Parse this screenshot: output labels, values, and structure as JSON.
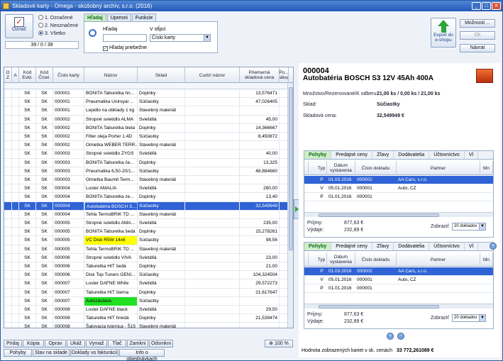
{
  "window": {
    "title": "Skladové karty - Omega - skúšobný archív, s.r.o. (2016)"
  },
  "top": {
    "mark_label": "Označ",
    "radio": [
      "1. Označené",
      "2. Neoznačené",
      "3. Všetko"
    ],
    "counter": "39 / 0 / 39",
    "tabs": [
      "Hľadaj",
      "Upresni",
      "Funkcie"
    ],
    "search_label": "Hľadaj",
    "search_value": "",
    "column_label": "V stĺpci",
    "column_value": "Číslo karty",
    "progressive_label": "Hľadaj priebežne",
    "export_label": "Export do e-shopu",
    "options_label": "Možnosti ...",
    "ok_label": "Ok",
    "return_label": "Návrat"
  },
  "grid": {
    "headers": [
      "O Z",
      "A",
      "Kód Evid.",
      "Kód Čísel.",
      "Číslo karty",
      "Názov",
      "Sklad",
      "Cudzí názov",
      "Priemerná skladová cena",
      "Po... nákup"
    ],
    "rows": [
      [
        "SK",
        "SK",
        "000001",
        "BONITA Taburetka hn...",
        "Doplnky",
        "13,576471",
        ""
      ],
      [
        "SK",
        "SK",
        "000001",
        "Pneumatika Uniroyal ...",
        "Súčiastky",
        "47,026405",
        ""
      ],
      [
        "SK",
        "SK",
        "000001",
        "Lepidlo na obklady 1 kg",
        "Stavebný materiál",
        "",
        ""
      ],
      [
        "SK",
        "SK",
        "000002",
        "Stropné svietidlo ALMA",
        "Svietidlá",
        "45,00",
        ""
      ],
      [
        "SK",
        "SK",
        "000002",
        "BONITA Taburetka biela",
        "Doplnky",
        "14,366667",
        ""
      ],
      [
        "SK",
        "SK",
        "000002",
        "Filter oleja Porter 1.4D",
        "Súčiastky",
        "8,450872",
        ""
      ],
      [
        "SK",
        "SK",
        "000002",
        "Omietka WEBER TERR...",
        "Stavebný materiál",
        "",
        ""
      ],
      [
        "SK",
        "SK",
        "000003",
        "Stropné svietidlo ZYGS",
        "Svietidlá",
        "40,00",
        ""
      ],
      [
        "SK",
        "SK",
        "000003",
        "BONITA Taburetka če...",
        "Doplnky",
        "13,325",
        ""
      ],
      [
        "SK",
        "SK",
        "000003",
        "Pneumatika 6,50-20/1...",
        "Súčiastky",
        "48,884660",
        ""
      ],
      [
        "SK",
        "SK",
        "000003",
        "Omietka Baumit Term...",
        "Stavebný materiál",
        "",
        ""
      ],
      [
        "SK",
        "SK",
        "000004",
        "Luster AMALIA",
        "Svietidlá",
        "280,00",
        ""
      ],
      [
        "SK",
        "SK",
        "000004",
        "BONITA Taburetka ze...",
        "Doplnky",
        "13,40",
        ""
      ],
      [
        "SK",
        "SK",
        "000004",
        "Autobatéria BOSCH S...",
        "Súčiastky",
        "32,549949",
        "sel"
      ],
      [
        "SK",
        "SK",
        "000004",
        "Tehla TermoBRIK TD ...",
        "Stavebný materiál",
        "",
        ""
      ],
      [
        "SK",
        "SK",
        "000005",
        "Stropné svietidlo AMA...",
        "Svietidlá",
        "235,00",
        ""
      ],
      [
        "SK",
        "SK",
        "000005",
        "BONITA Taburetka šedá",
        "Doplnky",
        "15,278261",
        ""
      ],
      [
        "SK",
        "SK",
        "000005",
        "VC Disk R5W 14x6",
        "Súčiastky",
        "98,56",
        "yellow"
      ],
      [
        "SK",
        "SK",
        "000005",
        "Tehla TermoBRIK TD ...",
        "Stavebný materiál",
        "",
        ""
      ],
      [
        "SK",
        "SK",
        "000006",
        "Stropné svietidlo VIVA",
        "Svietidlá",
        "23,00",
        ""
      ],
      [
        "SK",
        "SK",
        "000006",
        "Taburetka HIT šedá",
        "Doplnky",
        "21,00",
        ""
      ],
      [
        "SK",
        "SK",
        "000006",
        "Disk Top Tuners GENI...",
        "Súčiastky",
        "104,324504",
        ""
      ],
      [
        "SK",
        "SK",
        "000007",
        "Luster DAFNE White",
        "Svietidlá",
        "29,572273",
        ""
      ],
      [
        "SK",
        "SK",
        "000007",
        "Taburetka HIT čierna",
        "Doplnky",
        "21,617647",
        ""
      ],
      [
        "SK",
        "SK",
        "000007",
        "Autozástava",
        "Súčiastky",
        "",
        "green"
      ],
      [
        "SK",
        "SK",
        "000008",
        "Luster DAFNE black",
        "Svietidlá",
        "29,50",
        ""
      ],
      [
        "SK",
        "SK",
        "000008",
        "Taburetka HIT hnedá",
        "Doplnky",
        "21,539474",
        ""
      ],
      [
        "SK",
        "SK",
        "000008",
        "Šalovacia tvárnica - Š15",
        "Stavebný materiál",
        "",
        ""
      ]
    ]
  },
  "bottom": {
    "row1": [
      "Pridaj",
      "Kópia",
      "Oprav",
      "Ukáž",
      "Vymaž",
      "Tlač",
      "Zamkni",
      "Odomkni"
    ],
    "zoom": "100 %",
    "row2": [
      "Pohyby",
      "Stav na sklade",
      "Doklady vo fakturácii",
      "Info o objednávkach"
    ]
  },
  "detail": {
    "code": "000004",
    "name": "Autobatéria BOSCH S3 12V 45Ah 400A",
    "qty_label": "Množstvo/Rezervované/K odberu:",
    "qty_value": "21,00 ks / 0,00 ks / 21,00 ks",
    "store_label": "Sklad:",
    "store_value": "Súčiastky",
    "price_label": "Skladová cena:",
    "price_value": "32,549949 €"
  },
  "sub": {
    "tabs": [
      "Pohyby",
      "Predajné ceny",
      "Zľavy",
      "Dodávatelia",
      "Účtovníctvo",
      "Vl"
    ],
    "headers": [
      "Typ",
      "Dátum vystavenia",
      "Číslo dokladu",
      "Partner",
      "Mn"
    ],
    "rows": [
      [
        "P",
        "01.03.2016",
        "000002",
        "AA Cars, s.r.o.",
        "sel"
      ],
      [
        "V",
        "05.01.2016",
        "000001",
        "Auto, CZ",
        ""
      ],
      [
        "P",
        "01.01.2016",
        "000001",
        "",
        ""
      ]
    ],
    "income_label": "Príjmy:",
    "income_value": "877,63 €",
    "expense_label": "Výdaje:",
    "expense_value": "232,89 €",
    "show_label": "Zobraziť",
    "show_value": "20 dokladov"
  },
  "footer": {
    "label": "Hodnota zobrazených kariet v sk. cenách",
    "value": "33 772,261089 €"
  }
}
